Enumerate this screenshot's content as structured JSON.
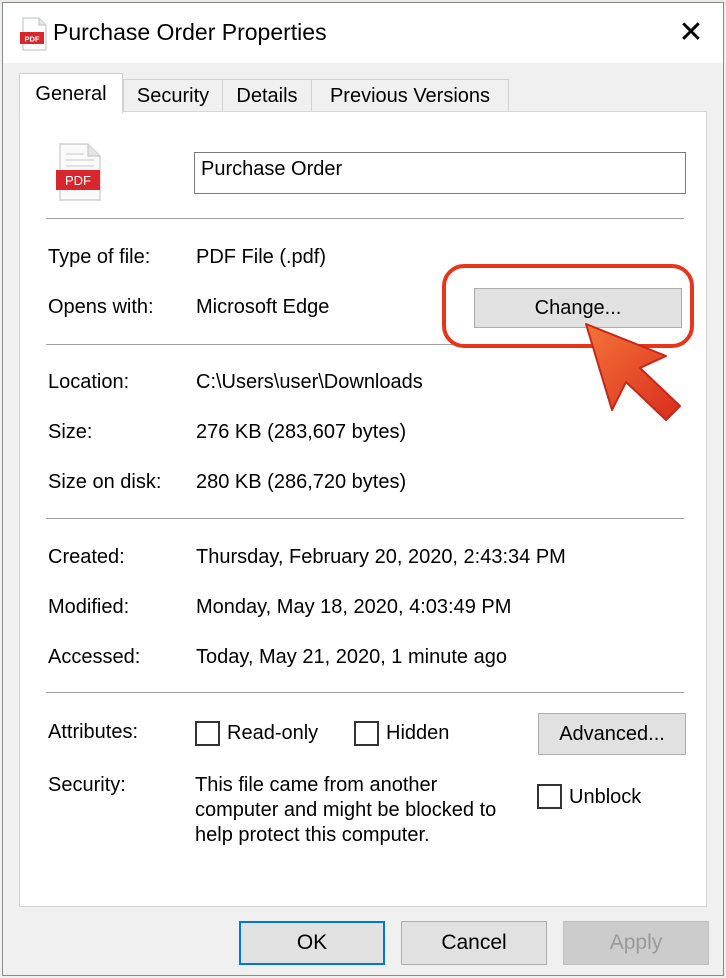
{
  "window": {
    "title": "Purchase Order Properties",
    "close_glyph": "✕",
    "title_icon": "pdf-file-icon"
  },
  "tabs": [
    {
      "label": "General",
      "active": true
    },
    {
      "label": "Security",
      "active": false
    },
    {
      "label": "Details",
      "active": false
    },
    {
      "label": "Previous Versions",
      "active": false
    }
  ],
  "general": {
    "file_icon_label": "PDF",
    "file_name": "Purchase Order",
    "type_label": "Type of file:",
    "type_value": "PDF File (.pdf)",
    "opens_label": "Opens with:",
    "opens_value": "Microsoft Edge",
    "change_button": "Change...",
    "location_label": "Location:",
    "location_value": "C:\\Users\\user\\Downloads",
    "size_label": "Size:",
    "size_value": "276 KB (283,607 bytes)",
    "size_disk_label": "Size on disk:",
    "size_disk_value": "280 KB (286,720 bytes)",
    "created_label": "Created:",
    "created_value": "Thursday, February 20, 2020, 2:43:34 PM",
    "modified_label": "Modified:",
    "modified_value": "Monday, May 18, 2020, 4:03:49 PM",
    "accessed_label": "Accessed:",
    "accessed_value": "Today, May 21, 2020, 1 minute ago",
    "attributes_label": "Attributes:",
    "readonly_label": "Read-only",
    "readonly_checked": false,
    "hidden_label": "Hidden",
    "hidden_checked": false,
    "advanced_button": "Advanced...",
    "security_label": "Security:",
    "security_line1": "This file came from another",
    "security_line2": "computer and might be blocked to",
    "security_line3": "help protect this computer.",
    "unblock_label": "Unblock",
    "unblock_checked": false
  },
  "footer": {
    "ok": "OK",
    "cancel": "Cancel",
    "apply": "Apply",
    "apply_enabled": false
  },
  "annotation": {
    "highlight_color": "#e8341a",
    "arrow_color": "#ea4a26"
  },
  "colors": {
    "accent": "#0078d7",
    "pdf_red": "#d9262c"
  }
}
